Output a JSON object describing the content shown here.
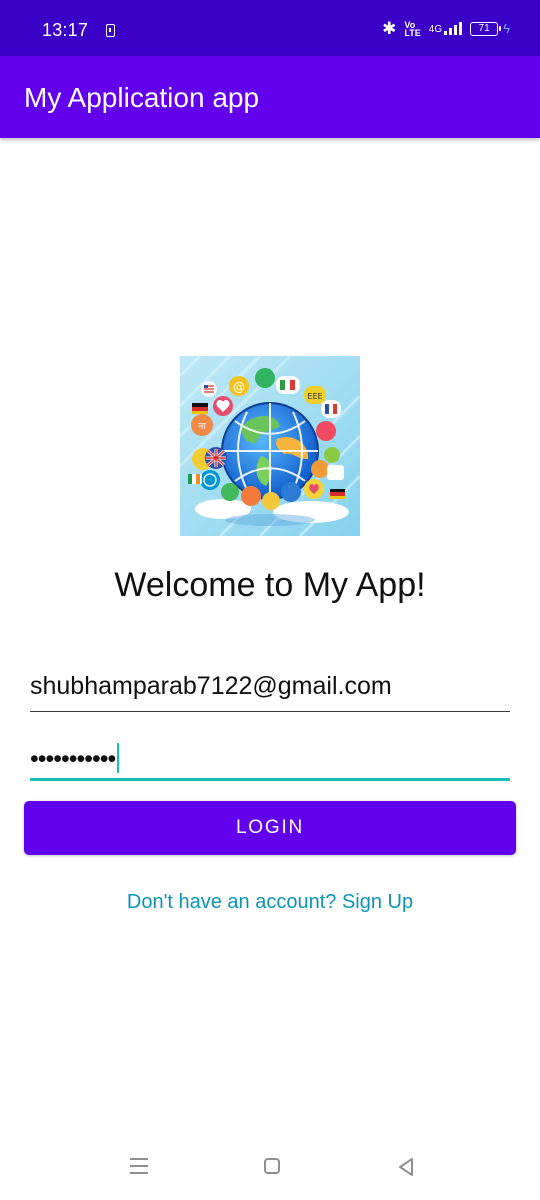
{
  "status_bar": {
    "time": "13:17",
    "volte_top": "Vo",
    "volte_bottom": "LTE",
    "network": "4G",
    "battery": "71"
  },
  "app_bar": {
    "title": "My Application app"
  },
  "welcome": {
    "title": "Welcome to My App!"
  },
  "form": {
    "email_value": "shubhamparab7122@gmail.com",
    "password_value": "•••••••••••",
    "login_label": "LOGIN",
    "signup_text": "Don't have an account? Sign Up"
  },
  "logo": {
    "logo_text": "EEE"
  },
  "colors": {
    "primary": "#6200ee",
    "status_bar": "#3a00c8",
    "accent": "#16c0b7",
    "link": "#0d93b4"
  },
  "icons": {
    "status": [
      "notification-icon",
      "bluetooth-icon",
      "volte-icon",
      "signal-icon",
      "battery-icon",
      "charging-icon"
    ],
    "nav": [
      "recents-icon",
      "home-icon",
      "back-icon"
    ]
  }
}
